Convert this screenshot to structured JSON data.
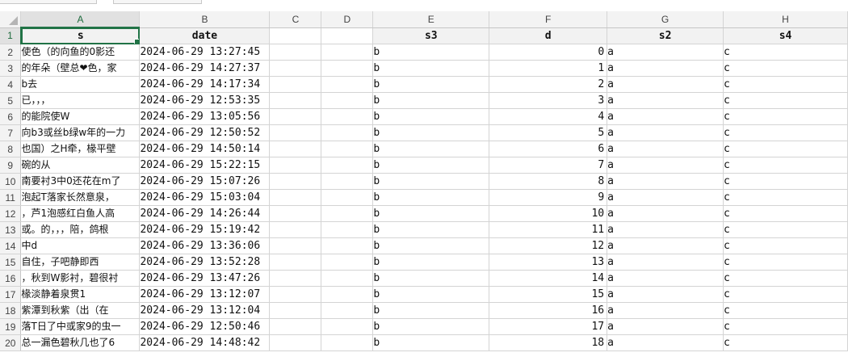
{
  "columns": [
    "A",
    "B",
    "C",
    "D",
    "E",
    "F",
    "G",
    "H"
  ],
  "selected_column": "A",
  "headers": [
    "s",
    "date",
    "",
    "",
    "s3",
    "d",
    "s2",
    "s4"
  ],
  "rows": [
    {
      "n": "2",
      "s": "使色（的向鱼的0影还",
      "date": "2024-06-29 13:27:45",
      "s3": "b",
      "d": "0",
      "s2": "a",
      "s4": "c"
    },
    {
      "n": "3",
      "s": "的年朵（壁总❤色，家",
      "date": "2024-06-29 14:27:37",
      "s3": "b",
      "d": "1",
      "s2": "a",
      "s4": "c"
    },
    {
      "n": "4",
      "s": "b去",
      "date": "2024-06-29 14:17:34",
      "s3": "b",
      "d": "2",
      "s2": "a",
      "s4": "c"
    },
    {
      "n": "5",
      "s": "已，，，",
      "date": "2024-06-29 12:53:35",
      "s3": "b",
      "d": "3",
      "s2": "a",
      "s4": "c"
    },
    {
      "n": "6",
      "s": "的能院使W",
      "date": "2024-06-29 13:05:56",
      "s3": "b",
      "d": "4",
      "s2": "a",
      "s4": "c"
    },
    {
      "n": "7",
      "s": "向b3或丝b绿w年的一力",
      "date": "2024-06-29 12:50:52",
      "s3": "b",
      "d": "5",
      "s2": "a",
      "s4": "c"
    },
    {
      "n": "8",
      "s": "也国）之H牵，椽平壁",
      "date": "2024-06-29 14:50:14",
      "s3": "b",
      "d": "6",
      "s2": "a",
      "s4": "c"
    },
    {
      "n": "9",
      "s": "碗的从",
      "date": "2024-06-29 15:22:15",
      "s3": "b",
      "d": "7",
      "s2": "a",
      "s4": "c"
    },
    {
      "n": "10",
      "s": "南要衬3中0还花在m了",
      "date": "2024-06-29 15:07:26",
      "s3": "b",
      "d": "8",
      "s2": "a",
      "s4": "c"
    },
    {
      "n": "11",
      "s": "泡起T落家长然意泉，",
      "date": "2024-06-29 15:03:04",
      "s3": "b",
      "d": "9",
      "s2": "a",
      "s4": "c"
    },
    {
      "n": "12",
      "s": "，芦1泡感红白鱼人高",
      "date": "2024-06-29 14:26:44",
      "s3": "b",
      "d": "10",
      "s2": "a",
      "s4": "c"
    },
    {
      "n": "13",
      "s": "或。的，，，陪，鸽根",
      "date": "2024-06-29 15:19:42",
      "s3": "b",
      "d": "11",
      "s2": "a",
      "s4": "c"
    },
    {
      "n": "14",
      "s": "中d",
      "date": "2024-06-29 13:36:06",
      "s3": "b",
      "d": "12",
      "s2": "a",
      "s4": "c"
    },
    {
      "n": "15",
      "s": "自住，子吧静即西",
      "date": "2024-06-29 13:52:28",
      "s3": "b",
      "d": "13",
      "s2": "a",
      "s4": "c"
    },
    {
      "n": "16",
      "s": "，秋到W影衬，碧很衬",
      "date": "2024-06-29 13:47:26",
      "s3": "b",
      "d": "14",
      "s2": "a",
      "s4": "c"
    },
    {
      "n": "17",
      "s": "椽淡静着泉贯1",
      "date": "2024-06-29 13:12:07",
      "s3": "b",
      "d": "15",
      "s2": "a",
      "s4": "c"
    },
    {
      "n": "18",
      "s": "紫潭到秋紫（出（在",
      "date": "2024-06-29 13:12:04",
      "s3": "b",
      "d": "16",
      "s2": "a",
      "s4": "c"
    },
    {
      "n": "19",
      "s": "落T日了中或家9的虫一",
      "date": "2024-06-29 12:50:46",
      "s3": "b",
      "d": "17",
      "s2": "a",
      "s4": "c"
    },
    {
      "n": "20",
      "s": "总一漏色碧秋几也了6",
      "date": "2024-06-29 14:48:42",
      "s3": "b",
      "d": "18",
      "s2": "a",
      "s4": "c"
    }
  ],
  "colors": {
    "accent": "#217346",
    "header_bg": "#f3f3f3",
    "gridline": "#d4d4d4"
  }
}
